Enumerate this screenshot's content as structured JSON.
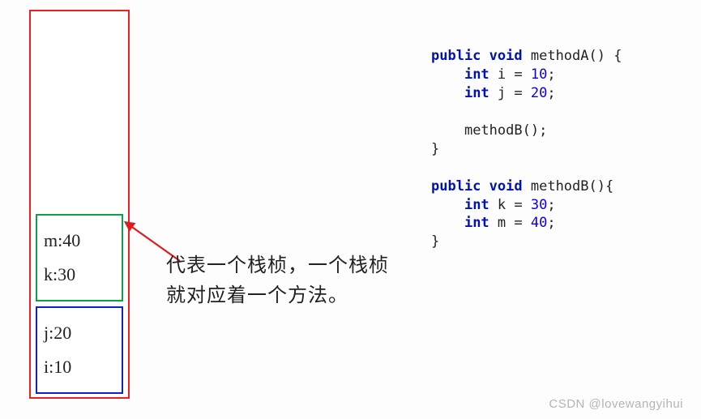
{
  "stack": {
    "frame_green": {
      "line1": "m:40",
      "line2": "k:30"
    },
    "frame_blue": {
      "line1": "j:20",
      "line2": "i:10"
    }
  },
  "annotation": {
    "line1": "代表一个栈桢，一个栈桢",
    "line2": "就对应着一个方法。"
  },
  "code": {
    "kw_public": "public",
    "kw_void": "void",
    "kw_int": "int",
    "methodA_sig": " methodA() {",
    "decl_i": " i = ",
    "val_i": "10",
    "decl_j": " j = ",
    "val_j": "20",
    "call_b": "methodB();",
    "close": "}",
    "methodB_sig": " methodB(){",
    "decl_k": " k = ",
    "val_k": "30",
    "decl_m": " m = ",
    "val_m": "40",
    "semi": ";"
  },
  "watermark": "CSDN @lovewangyihui"
}
